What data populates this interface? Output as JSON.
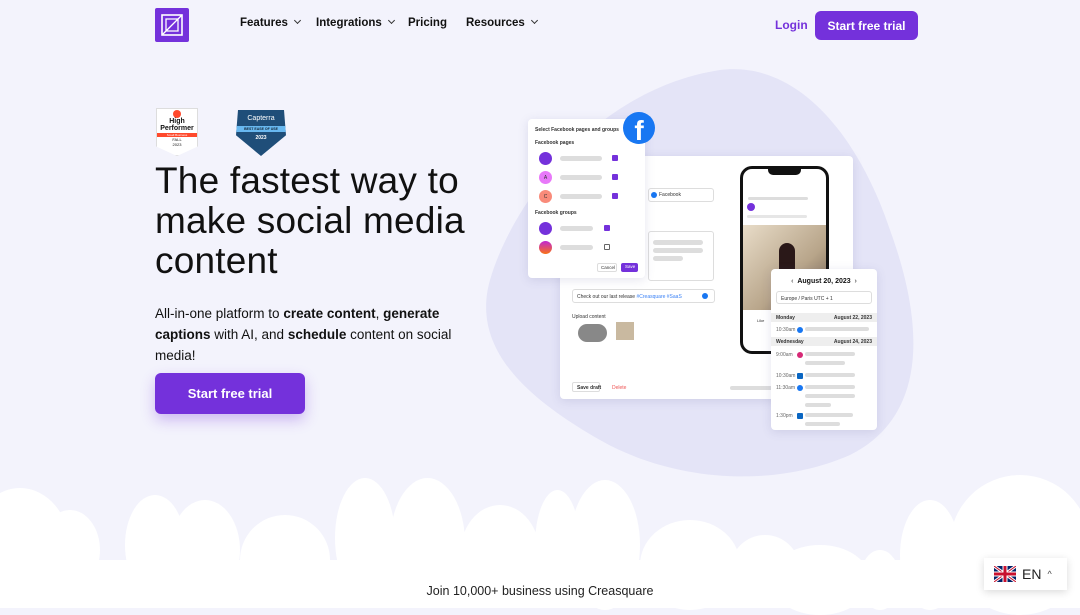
{
  "nav": {
    "items": [
      {
        "label": "Features",
        "dropdown": true
      },
      {
        "label": "Integrations",
        "dropdown": true
      },
      {
        "label": "Pricing",
        "dropdown": false
      },
      {
        "label": "Resources",
        "dropdown": true
      }
    ],
    "login": "Login",
    "cta": "Start free trial"
  },
  "badges": {
    "g2": {
      "title": "High Performer",
      "band": "Small Business",
      "season": "FALL",
      "year": "2023"
    },
    "capterra": {
      "brand": "Capterra",
      "band": "BEST EASE OF USE",
      "year": "2023"
    }
  },
  "hero": {
    "title": "The fastest way to make social media content",
    "sub_1": "All-in-one platform to ",
    "sub_b1": "create content",
    "sub_2": ", ",
    "sub_b2": "generate captions",
    "sub_3": " with AI, and ",
    "sub_b3": "schedule",
    "sub_4": " content on social media!",
    "cta": "Start free trial"
  },
  "mockup": {
    "popup_title": "Select Facebook pages and groups",
    "pages_label": "Facebook pages",
    "groups_label": "Facebook groups",
    "page_avatars": [
      "A",
      "C"
    ],
    "cancel": "Cancel",
    "save": "Save",
    "channel_chip": "Facebook",
    "caption": "Check out our last release ",
    "hashtags": "#Creasquare #SaaS",
    "upload_label": "Upload content",
    "save_draft": "Save draft",
    "delete": "Delete",
    "like": "Like"
  },
  "calendar": {
    "date": "August 20, 2023",
    "timezone": "Europe / Paris UTC + 1",
    "days": [
      {
        "day": "Monday",
        "date": "August 22, 2023",
        "slots": [
          {
            "time": "10:30am",
            "network": "facebook"
          }
        ]
      },
      {
        "day": "Wednesday",
        "date": "August 24, 2023",
        "slots": [
          {
            "time": "9:00am",
            "network": "instagram"
          },
          {
            "time": "10:30am",
            "network": "linkedin"
          },
          {
            "time": "11:30am",
            "network": "facebook"
          },
          {
            "time": "1:30pm",
            "network": "linkedin"
          }
        ]
      }
    ]
  },
  "footer": {
    "join": "Join 10,000+ business using Creasquare"
  },
  "language": {
    "code": "EN"
  },
  "colors": {
    "brand": "#7431db",
    "background": "#f3f3fc",
    "blob": "#e4e4f7",
    "facebook": "#1877f2"
  }
}
